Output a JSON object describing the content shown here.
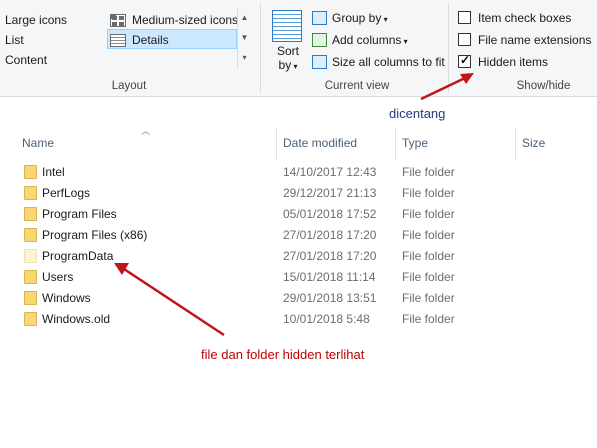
{
  "ribbon": {
    "layout": {
      "group_label": "Layout",
      "items": [
        {
          "label": "Large icons"
        },
        {
          "label": "Medium-sized icons"
        },
        {
          "label": "List"
        },
        {
          "label": "Details",
          "selected": true
        },
        {
          "label": "Content"
        }
      ]
    },
    "current_view": {
      "group_label": "Current view",
      "sort_label": "Sort by",
      "group_by": "Group by",
      "add_columns": "Add columns",
      "size_all_columns": "Size all columns to fit"
    },
    "show_hide": {
      "group_label": "Show/hide",
      "checkboxes": [
        {
          "label": "Item check boxes",
          "checked": false
        },
        {
          "label": "File name extensions",
          "checked": false
        },
        {
          "label": "Hidden items",
          "checked": true
        }
      ]
    }
  },
  "annotations": {
    "hidden_items_note": "dicentang",
    "hidden_folder_note": "file dan folder hidden terlihat",
    "arrow_color": "#c0151b"
  },
  "columns": [
    "Name",
    "Date modified",
    "Type",
    "Size"
  ],
  "files": [
    {
      "name": "Intel",
      "date": "14/10/2017 12:43",
      "type": "File folder",
      "hidden": false
    },
    {
      "name": "PerfLogs",
      "date": "29/12/2017 21:13",
      "type": "File folder",
      "hidden": false
    },
    {
      "name": "Program Files",
      "date": "05/01/2018 17:52",
      "type": "File folder",
      "hidden": false
    },
    {
      "name": "Program Files (x86)",
      "date": "27/01/2018 17:20",
      "type": "File folder",
      "hidden": false
    },
    {
      "name": "ProgramData",
      "date": "27/01/2018 17:20",
      "type": "File folder",
      "hidden": true
    },
    {
      "name": "Users",
      "date": "15/01/2018 11:14",
      "type": "File folder",
      "hidden": false
    },
    {
      "name": "Windows",
      "date": "29/01/2018 13:51",
      "type": "File folder",
      "hidden": false
    },
    {
      "name": "Windows.old",
      "date": "10/01/2018 5:48",
      "type": "File folder",
      "hidden": false
    }
  ]
}
